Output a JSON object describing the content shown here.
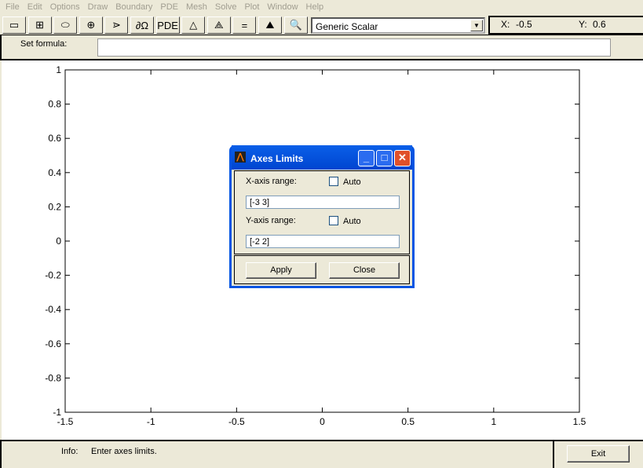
{
  "menubar": [
    "File",
    "Edit",
    "Options",
    "Draw",
    "Boundary",
    "PDE",
    "Mesh",
    "Solve",
    "Plot",
    "Window",
    "Help"
  ],
  "toolbar": {
    "buttons": [
      {
        "icon": "rectangle-icon",
        "glyph": "▭"
      },
      {
        "icon": "rectangle-center-icon",
        "glyph": "⊞"
      },
      {
        "icon": "ellipse-icon",
        "glyph": "⬭"
      },
      {
        "icon": "ellipse-center-icon",
        "glyph": "⊕"
      },
      {
        "icon": "polygon-icon",
        "glyph": "⋗"
      },
      {
        "icon": "boundary-icon",
        "glyph": "∂Ω"
      },
      {
        "icon": "pde-icon",
        "glyph": "PDE"
      },
      {
        "icon": "mesh-icon",
        "glyph": "△"
      },
      {
        "icon": "refine-mesh-icon",
        "glyph": "⟁"
      },
      {
        "icon": "solve-icon",
        "glyph": "="
      },
      {
        "icon": "plot-icon",
        "glyph": "⛰"
      },
      {
        "icon": "zoom-icon",
        "glyph": "🔍"
      }
    ],
    "application_mode": "Generic Scalar",
    "x_label": "X:",
    "x_value": "-0.5",
    "y_label": "Y:",
    "y_value": "0.6"
  },
  "formula": {
    "label": "Set formula:",
    "value": ""
  },
  "chart_data": {
    "type": "line",
    "xlim": [
      -1.5,
      1.5
    ],
    "ylim": [
      -1,
      1
    ],
    "xticks": [
      "-1.5",
      "-1",
      "-0.5",
      "0",
      "0.5",
      "1",
      "1.5"
    ],
    "yticks": [
      "1",
      "0.8",
      "0.6",
      "0.4",
      "0.2",
      "0",
      "-0.2",
      "-0.4",
      "-0.6",
      "-0.8",
      "-1"
    ],
    "series": []
  },
  "dialog": {
    "title": "Axes Limits",
    "x_label": "X-axis range:",
    "x_auto": "Auto",
    "x_auto_checked": false,
    "x_value": "[-3 3]",
    "y_label": "Y-axis range:",
    "y_auto": "Auto",
    "y_auto_checked": false,
    "y_value": "[-2 2]",
    "apply": "Apply",
    "close": "Close"
  },
  "status": {
    "info_label": "Info:",
    "info_text": "Enter axes limits.",
    "exit": "Exit"
  }
}
